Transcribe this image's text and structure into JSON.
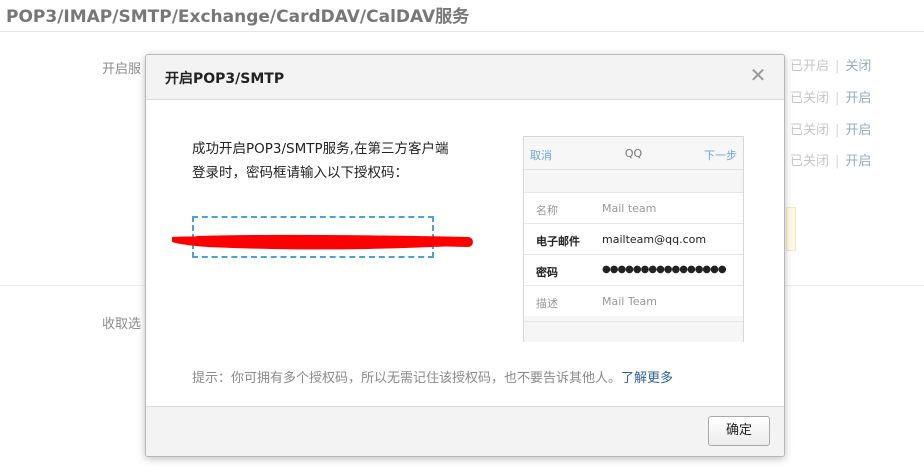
{
  "page": {
    "title": "POP3/IMAP/SMTP/Exchange/CardDAV/CalDAV服务",
    "label_enable": "开启服",
    "label_receive": "收取选",
    "status_rows": [
      {
        "state": "已开启",
        "sep": "|",
        "action": "关闭"
      },
      {
        "state": "已关闭",
        "sep": "|",
        "action": "开启"
      },
      {
        "state": "已关闭",
        "sep": "|",
        "action": "开启"
      },
      {
        "state": "已关闭",
        "sep": "|",
        "action": "开启"
      }
    ]
  },
  "dialog": {
    "title": "开启POP3/SMTP",
    "close_glyph": "✕",
    "body_line1": "成功开启POP3/SMTP服务,在第三方客户端",
    "body_line2": "登录时，密码框请输入以下授权码：",
    "auth_code": "",
    "phone": {
      "cancel": "取消",
      "header_title": "QQ",
      "next": "下一步",
      "rows": [
        {
          "label": "名称",
          "value": "Mail team"
        },
        {
          "label": "电子邮件",
          "value": "mailteam@qq.com"
        },
        {
          "label": "密码",
          "value": "●●●●●●●●●●●●●●●●"
        },
        {
          "label": "描述",
          "value": "Mail Team"
        }
      ]
    },
    "tip_text": "提示：你可拥有多个授权码，所以无需记住该授权码，也不要告诉其他人。",
    "tip_link": "了解更多",
    "ok_label": "确定"
  },
  "colors": {
    "accent_link": "#2c64a6",
    "code_box_border": "#4aa3d8",
    "redaction": "#ff0000"
  }
}
